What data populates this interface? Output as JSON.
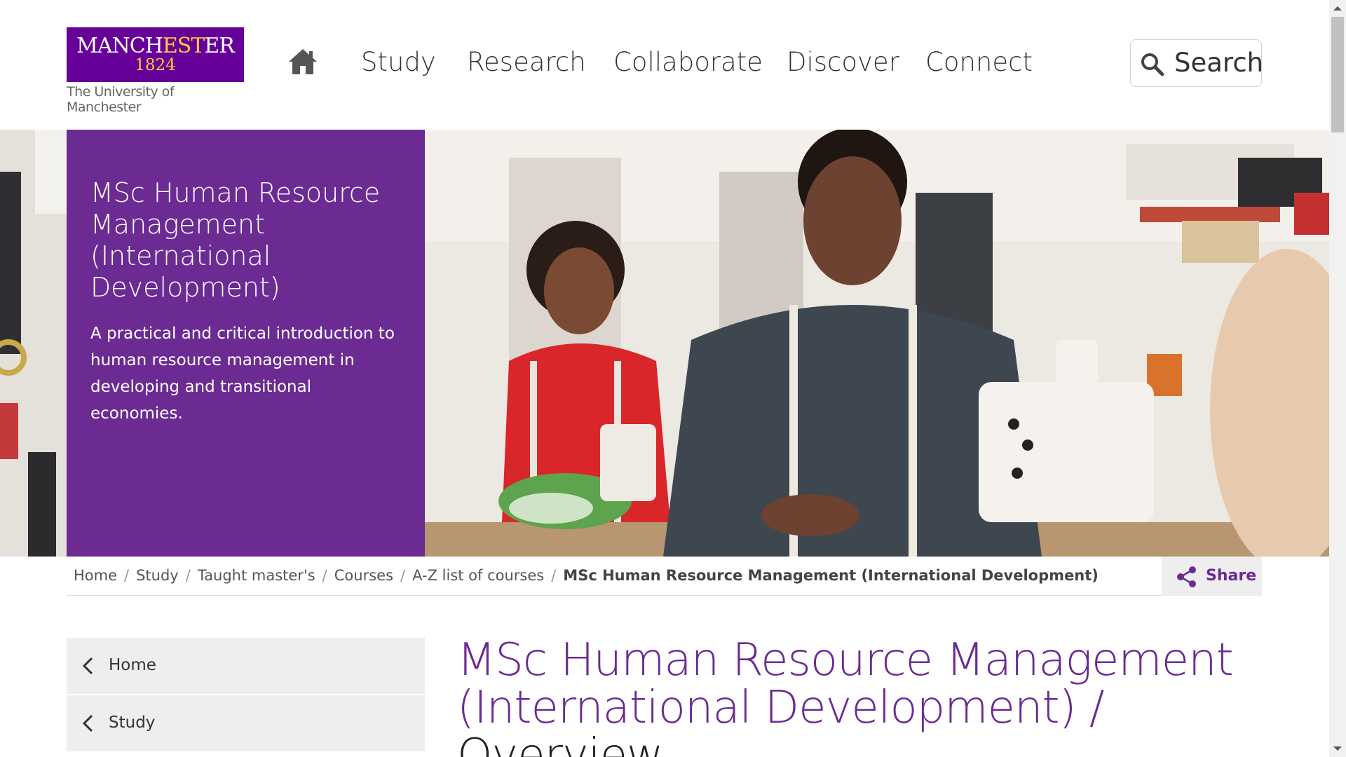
{
  "header": {
    "logo": {
      "wordmark_part1": "MANCH",
      "wordmark_part2": "EST",
      "wordmark_part3": "ER",
      "year": "1824",
      "subtitle": "The University of Manchester"
    },
    "nav": [
      "Study",
      "Research",
      "Collaborate",
      "Discover",
      "Connect"
    ],
    "search_label": "Search"
  },
  "hero": {
    "title": "MSc Human Resource Management (International Development)",
    "description": "A practical and critical introduction to human resource management in developing and transitional economies."
  },
  "breadcrumb": {
    "items": [
      "Home",
      "Study",
      "Taught master's",
      "Courses",
      "A-Z list of courses"
    ],
    "current": "MSc Human Resource Management (International Development)",
    "separator": "/"
  },
  "share_label": "Share",
  "side_nav": {
    "items": [
      "Home",
      "Study"
    ]
  },
  "page_title": {
    "main": "MSc Human Resource Management (International Development)",
    "separator": " / ",
    "section": "Overview"
  },
  "colors": {
    "brand_purple": "#660099",
    "panel_purple": "#6b2b93",
    "brand_gold": "#ffcc33"
  }
}
